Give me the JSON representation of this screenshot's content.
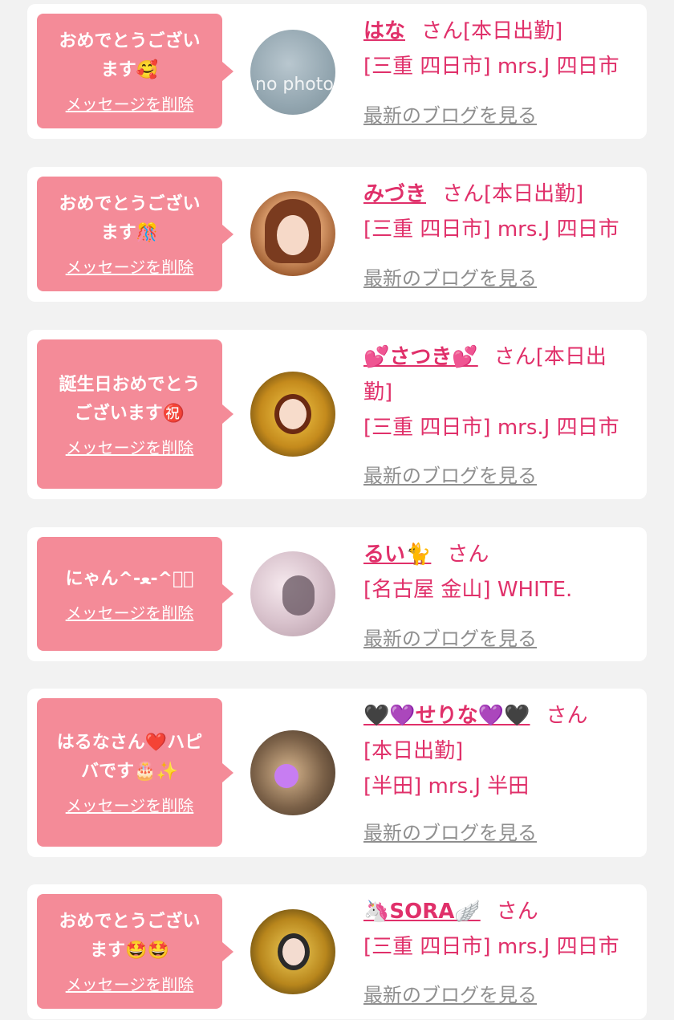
{
  "delete_label": "メッセージを削除",
  "san_label": "さん",
  "blog_label": "最新のブログを見る",
  "accent_color": "#e0306a",
  "bubble_color": "#f48b98",
  "cards": [
    {
      "message_lines": [
        "おめでとうござい",
        "ます🥰"
      ],
      "name": "はな",
      "status_inline": "[本日出勤]",
      "shop_lines": [
        "[三重 四日市] mrs.J 四日市"
      ],
      "avatar": "no-photo-avatar",
      "avatar_text": "no photo"
    },
    {
      "message_lines": [
        "おめでとうござい",
        "ます🎊"
      ],
      "name": "みづき",
      "status_inline": "[本日出勤]",
      "shop_lines": [
        "[三重 四日市] mrs.J 四日市"
      ],
      "avatar": "profile-avatar"
    },
    {
      "message_lines": [
        "誕生日おめでとう",
        "ございます㊗️"
      ],
      "name": "💕さつき💕",
      "status_inline": "[本日出",
      "shop_lines": [
        "勤]",
        "[三重 四日市] mrs.J 四日市"
      ],
      "avatar": "profile-avatar"
    },
    {
      "message_lines": [
        "にゃん^-ﻌ-^ฅ゙"
      ],
      "name": "るい🐈",
      "status_inline": "",
      "shop_lines": [
        "[名古屋 金山] WHITE."
      ],
      "avatar": "profile-avatar"
    },
    {
      "message_lines": [
        "はるなさん❤️ハピ",
        "バです🎂✨"
      ],
      "name": "🖤💜せりな💜🖤",
      "status_inline": "",
      "shop_lines": [
        "[本日出勤]",
        "[半田] mrs.J 半田"
      ],
      "avatar": "profile-avatar"
    },
    {
      "message_lines": [
        "おめでとうござい",
        "ます🤩🤩"
      ],
      "name": "🦄SORA🪽",
      "status_inline": "",
      "shop_lines": [
        "[三重 四日市] mrs.J 四日市"
      ],
      "avatar": "profile-avatar"
    }
  ]
}
